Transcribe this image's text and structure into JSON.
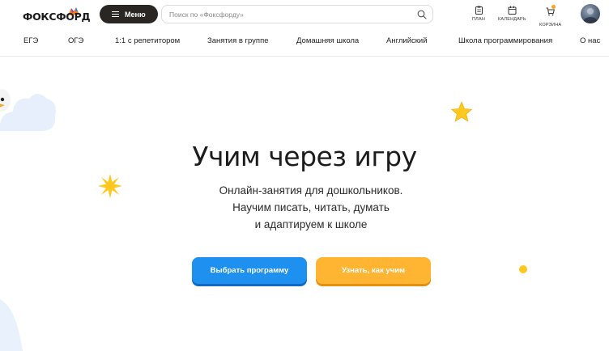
{
  "header": {
    "logo_text": "ФОКСФОРД",
    "menu_label": "Меню",
    "search_placeholder": "Поиск по «Фоксфорду»",
    "icons": [
      {
        "name": "plan",
        "label": "ПЛАН",
        "icon": "clipboard-icon"
      },
      {
        "name": "calendar",
        "label": "КАЛЕНДАРЬ",
        "icon": "calendar-icon"
      },
      {
        "name": "cart",
        "label": "КОРЗИНА",
        "icon": "cart-icon"
      }
    ]
  },
  "nav": {
    "items": [
      "ЕГЭ",
      "ОГЭ",
      "1:1 с репетитором",
      "Занятия в группе",
      "Домашняя школа",
      "Английский",
      "Школа программирования",
      "О нас"
    ]
  },
  "hero": {
    "title": "Учим через игру",
    "subtitle_lines": [
      "Онлайн-занятия для дошкольников.",
      "Научим писать, читать, думать",
      "и адаптируем к школе"
    ],
    "primary_button": "Выбрать программу",
    "secondary_button": "Узнать, как учим"
  },
  "colors": {
    "brand_dark": "#2a2623",
    "primary_blue": "#1e90f0",
    "accent_orange": "#ffb432",
    "star_yellow": "#ffc81e"
  }
}
